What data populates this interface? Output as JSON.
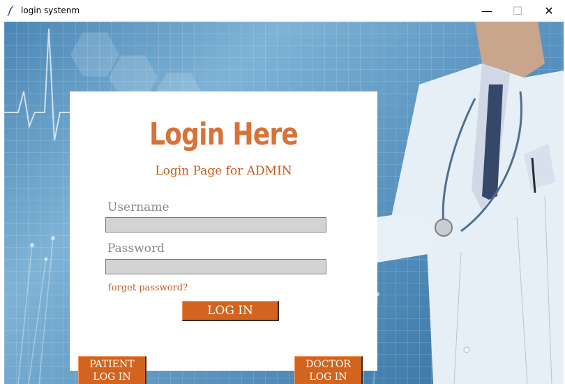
{
  "window": {
    "title": "login systenm",
    "minimize_glyph": "—",
    "maximize_glyph": "☐",
    "close_glyph": "✕"
  },
  "form": {
    "heading": "Login Here",
    "subtitle": "Login Page for ADMIN",
    "username_label": "Username",
    "username_value": "",
    "password_label": "Password",
    "password_value": "",
    "forgot_link": "forget password?",
    "login_button": "LOG IN"
  },
  "role_buttons": {
    "patient_line1": "PATIENT",
    "patient_line2": "LOG IN",
    "doctor_line1": "DOCTOR",
    "doctor_line2": "LOG IN"
  },
  "colors": {
    "accent": "#d2641f",
    "heading": "#d77238",
    "label": "#888888",
    "input_bg": "#d3d3d3"
  }
}
